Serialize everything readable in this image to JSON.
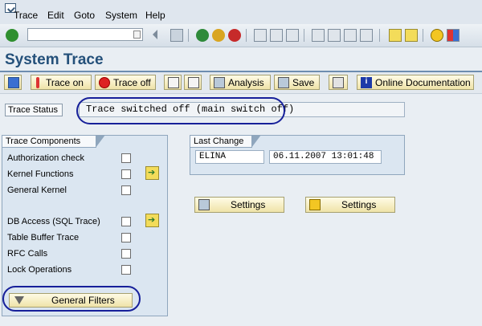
{
  "menu": [
    "Trace",
    "Edit",
    "Goto",
    "System",
    "Help"
  ],
  "page_title": "System Trace",
  "toolbar": {
    "trace_on": "Trace on",
    "trace_off": "Trace off",
    "analysis": "Analysis",
    "save": "Save",
    "online_doc": "Online Documentation"
  },
  "trace_status": {
    "label": "Trace Status",
    "value": "Trace switched off (main switch off)"
  },
  "trace_components": {
    "title": "Trace Components",
    "items": [
      {
        "label": "Authorization check",
        "checked": false
      },
      {
        "label": "Kernel Functions",
        "checked": false
      },
      {
        "label": "General Kernel",
        "checked": false
      },
      {
        "label": "DB Access (SQL Trace)",
        "checked": false
      },
      {
        "label": "Table Buffer Trace",
        "checked": false
      },
      {
        "label": "RFC Calls",
        "checked": false
      },
      {
        "label": "Lock Operations",
        "checked": false
      }
    ],
    "general_filters": "General Filters"
  },
  "last_change": {
    "title": "Last Change",
    "user": "ELINA",
    "timestamp": "06.11.2007 13:01:48"
  },
  "settings_buttons": [
    "Settings",
    "Settings"
  ],
  "colors": {
    "highlight_ellipse": "#17209a",
    "button_face": "#efe3a8",
    "title": "#24507a"
  }
}
